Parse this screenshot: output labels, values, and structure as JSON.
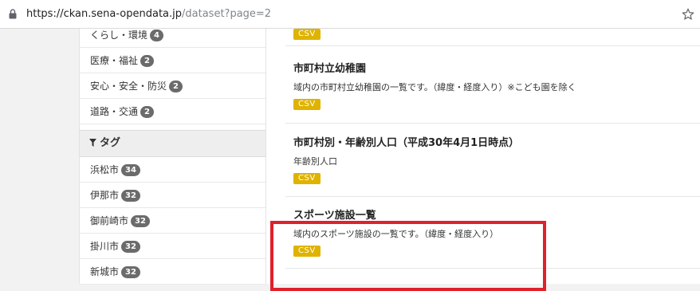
{
  "browser": {
    "url_host": "https://ckan.sena-opendata.jp",
    "url_path": "/dataset?page=2"
  },
  "sidebar": {
    "groups": [
      {
        "label": "くらし・環境",
        "count": "4"
      },
      {
        "label": "医療・福祉",
        "count": "2"
      },
      {
        "label": "安心・安全・防災",
        "count": "2"
      },
      {
        "label": "道路・交通",
        "count": "2"
      }
    ],
    "tags_header": "タグ",
    "tags": [
      {
        "label": "浜松市",
        "count": "34"
      },
      {
        "label": "伊那市",
        "count": "32"
      },
      {
        "label": "御前崎市",
        "count": "32"
      },
      {
        "label": "掛川市",
        "count": "32"
      },
      {
        "label": "新城市",
        "count": "32"
      }
    ]
  },
  "datasets": [
    {
      "title": "",
      "description": "",
      "format": "CSV"
    },
    {
      "title": "市町村立幼稚園",
      "description": "域内の市町村立幼稚園の一覧です。（緯度・経度入り）※こども園を除く",
      "format": "CSV"
    },
    {
      "title": "市町村別・年齢別人口（平成30年4月1日時点）",
      "description": "年齢別人口",
      "format": "CSV"
    },
    {
      "title": "スポーツ施設一覧",
      "description": "域内のスポーツ施設の一覧です。（緯度・経度入り）",
      "format": "CSV"
    }
  ],
  "colors": {
    "format_badge": "#dfb300",
    "highlight_box": "#e0202a",
    "count_badge": "#6b6b6b"
  }
}
